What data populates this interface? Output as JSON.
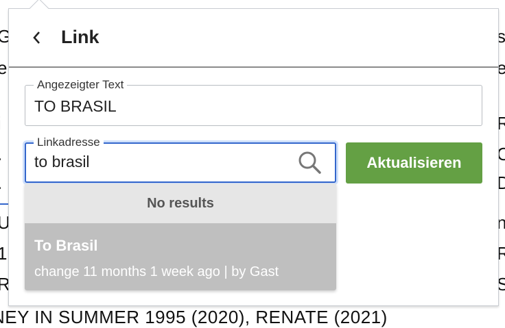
{
  "background": {
    "left_fragments": [
      "G",
      "e",
      "i",
      ".",
      ".",
      "U",
      "1",
      "R"
    ],
    "right_fragments": [
      "s",
      "e",
      "R",
      "O",
      "D",
      "n",
      "R",
      "S"
    ],
    "bottom_line": "NEY IN SUMMER 1995 (2020), RENATE (2021)"
  },
  "dialog": {
    "title": "Link",
    "back_icon": "chevron-left-icon",
    "displayed_text": {
      "label": "Angezeigter Text",
      "value": "TO BRASIL"
    },
    "link_address": {
      "label": "Linkadresse",
      "value": "to brasil",
      "icon": "search-icon"
    },
    "update_button": "Aktualisieren",
    "dropdown": {
      "no_results": "No results",
      "results": [
        {
          "title": "To Brasil",
          "meta": "change 11 months 1 week ago | by Gast"
        }
      ]
    }
  },
  "colors": {
    "accent": "#3366cc",
    "button": "#64a044"
  }
}
